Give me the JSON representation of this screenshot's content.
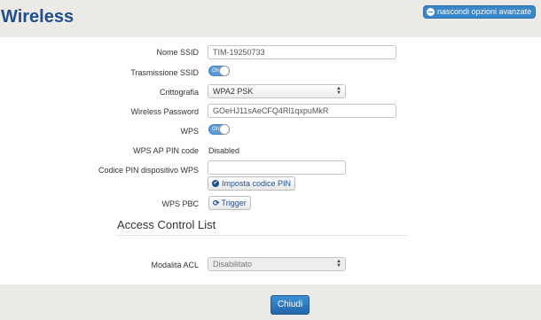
{
  "header": {
    "title": "Wireless",
    "advanced_button": "nascondi opzioni avanzate"
  },
  "form": {
    "ssid_label": "Nome SSID",
    "ssid_value": "TIM-19250733",
    "broadcast_label": "Trasmissione SSID",
    "broadcast_toggle": "On",
    "encryption_label": "Crittografia",
    "encryption_value": "WPA2 PSK",
    "password_label": "Wireless Password",
    "password_value": "GOeHJ11sAeCFQ4Rl1qxpuMkR",
    "wps_label": "WPS",
    "wps_toggle": "On",
    "wps_ap_pin_label": "WPS AP PIN code",
    "wps_ap_pin_value": "Disabled",
    "wps_device_pin_label": "Codice PIN dispositivo WPS",
    "wps_device_pin_value": "",
    "set_pin_button": "Imposta codice PIN",
    "wps_pbc_label": "WPS PBC",
    "trigger_button": "Trigger"
  },
  "acl": {
    "title": "Access Control List",
    "mode_label": "Modalità ACL",
    "mode_value": "Disabilitato"
  },
  "footer": {
    "close_button": "Chiudi"
  }
}
